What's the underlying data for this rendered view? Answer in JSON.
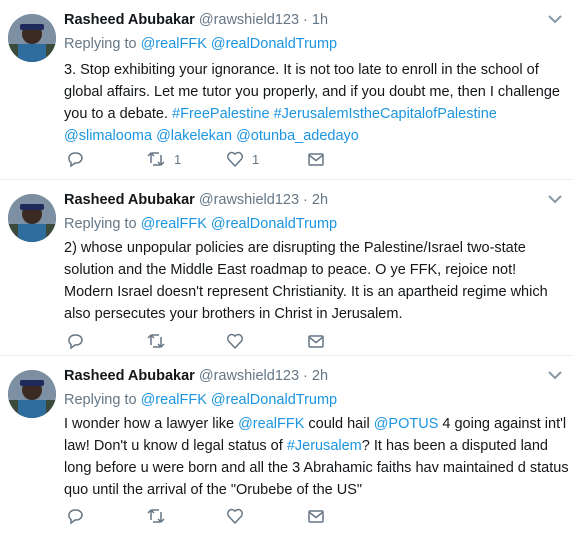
{
  "tweets": [
    {
      "name": "Rasheed Abubakar",
      "handle": "@rawshield123",
      "time": "· 1h",
      "replying_label": "Replying to",
      "replying_to": [
        "@realFFK",
        "@realDonaldTrump"
      ],
      "text_parts": [
        "3. Stop exhibiting your ignorance. It is not too late to enroll in the school of global affairs. Let me tutor you properly, and if you doubt me, then I challenge you to a debate. ",
        "#FreePalestine #JerusalemIstheCapitalofPalestine  @slimalooma @lakelekan @otunba_adedayo"
      ],
      "retweets": "1",
      "likes": "1"
    },
    {
      "name": "Rasheed Abubakar",
      "handle": "@rawshield123",
      "time": "· 2h",
      "replying_label": "Replying to",
      "replying_to": [
        "@realFFK",
        "@realDonaldTrump"
      ],
      "text": "2) whose unpopular policies are disrupting the Palestine/Israel two-state solution and the Middle East roadmap to peace. O ye FFK, rejoice not! Modern Israel doesn't represent Christianity. It is an apartheid regime which also persecutes your brothers in Christ in Jerusalem."
    },
    {
      "name": "Rasheed Abubakar",
      "handle": "@rawshield123",
      "time": "· 2h",
      "replying_label": "Replying to",
      "replying_to": [
        "@realFFK",
        "@realDonaldTrump"
      ],
      "text_parts": [
        "I wonder how a lawyer like ",
        "@realFFK",
        " could hail ",
        "@POTUS",
        " 4 going against int'l law! Don't u know d legal status of ",
        "#Jerusalem",
        "? It has been a disputed land long before u were born and all the 3 Abrahamic faiths hav maintained d status quo until the arrival of the \"Orubebe of the US\""
      ]
    }
  ]
}
